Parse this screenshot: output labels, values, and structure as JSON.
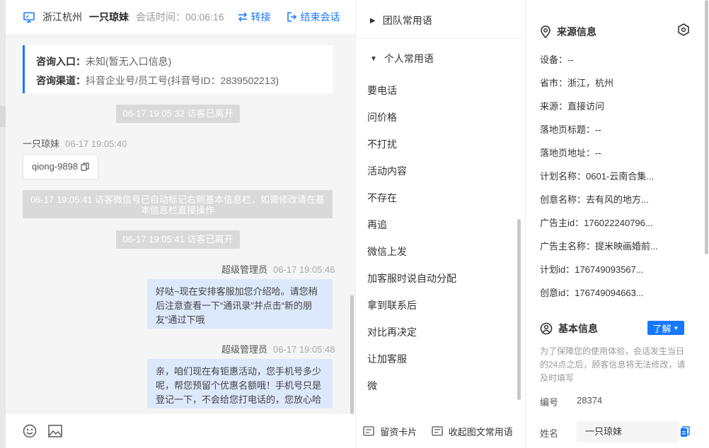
{
  "header": {
    "location": "浙江杭州",
    "visitor_name": "一只琼妹",
    "session_time": "会话时间：00:06:16",
    "transfer_label": "转接",
    "end_label": "结束会话"
  },
  "consult_card": {
    "entry_label": "咨询入口：",
    "entry_value": "未知(暂无入口信息)",
    "channel_label": "咨询渠道：",
    "channel_value": "抖音企业号/员工号(抖音号ID：2839502213)"
  },
  "messages": {
    "sys1": "06-17 19:05:32 访客已离开",
    "visitor_sender": "一只琼妹",
    "visitor_time": "06-17 19:05:40",
    "visitor_text": "qiong-9898",
    "sys2": "06-17 19:05:41 访客微信号已自动标记右侧基本信息栏，如需修改请在基本信息栏直接操作",
    "sys3": "06-17 19:05:41 访客已离开",
    "agent1_sender": "超级管理员",
    "agent1_time": "06-17 19:05:46",
    "agent1_text": "好哒~现在安排客服加您介绍哈。请您稍后注意查看一下“通讯录”并点击“新的朋友”通过下哦",
    "agent2_sender": "超级管理员",
    "agent2_time": "06-17 19:05:48",
    "agent2_text": "亲，咱们现在有钜惠活动，您手机号多少呢，帮您预留个优惠名额哦！手机号只是登记一下，不会给您打电话的，您放心哈"
  },
  "phrases": {
    "team_group": "团队常用语",
    "personal_group": "个人常用语",
    "items": [
      "要电话",
      "问价格",
      "不打扰",
      "活动内容",
      "不存在",
      "再追",
      "微信上发",
      "加客服时说自动分配",
      "拿到联系后",
      "对比再决定",
      "让加客服",
      "微"
    ],
    "footer_card": "留资卡片",
    "footer_collect": "收起图文常用语"
  },
  "source": {
    "title": "来源信息",
    "device": "设备：--",
    "province": "省市：浙江，杭州",
    "origin": "来源：直接访问",
    "landing_title": "落地页标题：--",
    "landing_url": "落地页地址：--",
    "plan_name": "计划名称：0601-云南合集...",
    "creative_name": "创意名称：去有风的地方...",
    "advertiser_id": "广告主id：176022240796...",
    "advertiser_name": "广告主名称：提米映画婚前...",
    "plan_id": "计划id：176749093567...",
    "creative_id": "创意id：176749094663..."
  },
  "basic": {
    "title": "基本信息",
    "learn_label": "了解",
    "note": "为了保障您的使用体验，会话发生当日的24点之后，顾客信息将无法修改，请及时填写",
    "id_label": "编号",
    "id_value": "28374",
    "name_label": "姓名",
    "name_value": "一只琼妹"
  },
  "colors": {
    "accent": "#1677ff",
    "bubble": "#dce8fb",
    "pill": "#d9d9d9"
  }
}
